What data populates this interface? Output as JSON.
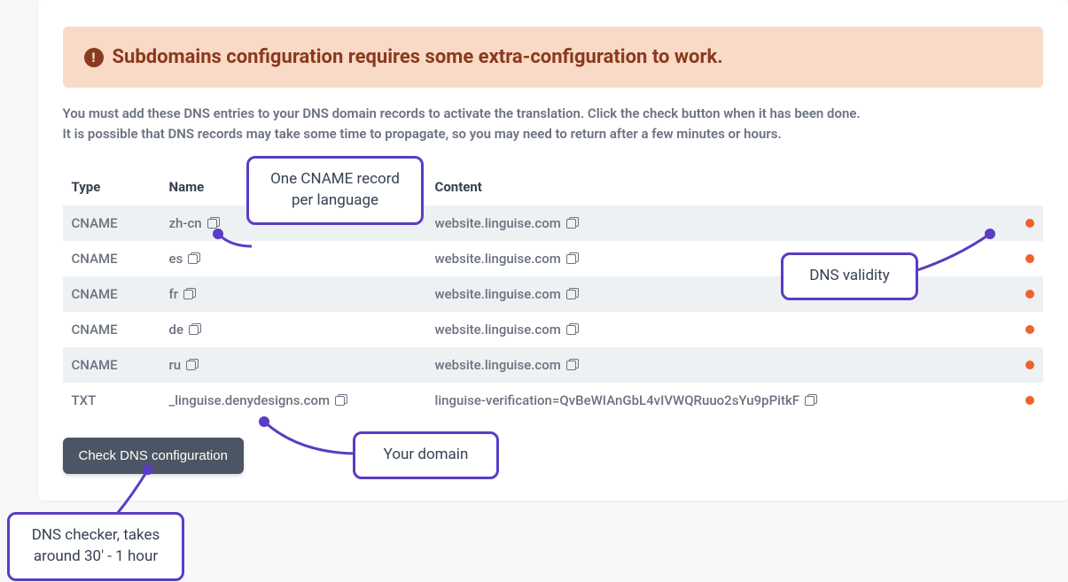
{
  "alert": {
    "icon_glyph": "!",
    "title": "Subdomains configuration requires some extra-configuration to work."
  },
  "instructions": {
    "line1": "You must add these DNS entries to your DNS domain records to activate the translation. Click the check button when it has been done.",
    "line2": "It is possible that DNS records may take some time to propagate, so you may need to return after a few minutes or hours."
  },
  "table": {
    "headers": {
      "type": "Type",
      "name": "Name",
      "content": "Content"
    },
    "rows": [
      {
        "type": "CNAME",
        "name": "zh-cn",
        "content": "website.linguise.com"
      },
      {
        "type": "CNAME",
        "name": "es",
        "content": "website.linguise.com"
      },
      {
        "type": "CNAME",
        "name": "fr",
        "content": "website.linguise.com"
      },
      {
        "type": "CNAME",
        "name": "de",
        "content": "website.linguise.com"
      },
      {
        "type": "CNAME",
        "name": "ru",
        "content": "website.linguise.com"
      },
      {
        "type": "TXT",
        "name": "_linguise.denydesigns.com",
        "content": "linguise-verification=QvBeWIAnGbL4vIVWQRuuo2sYu9pPitkF"
      }
    ]
  },
  "button": {
    "check_dns": "Check DNS configuration"
  },
  "annotations": {
    "cname_per_lang": "One CNAME record per language",
    "dns_validity": "DNS validity",
    "your_domain": "Your domain",
    "dns_checker": "DNS checker, takes around 30' - 1 hour"
  }
}
